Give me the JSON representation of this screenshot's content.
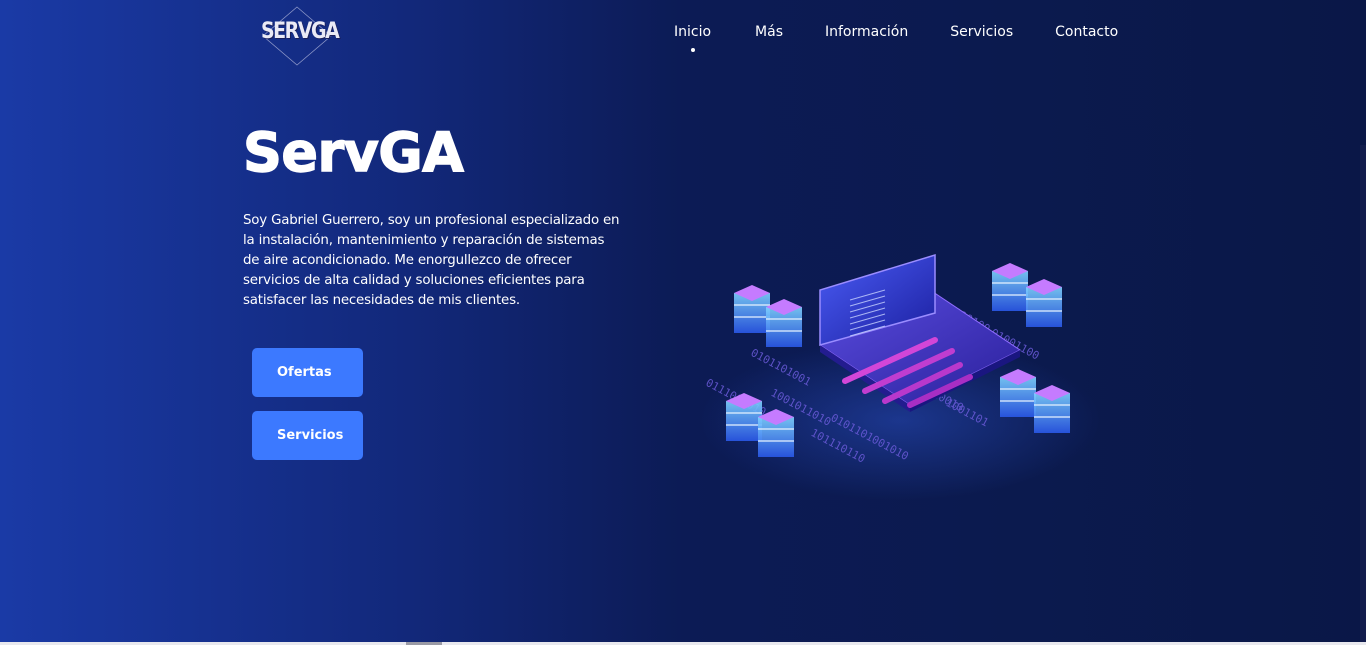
{
  "brand": {
    "logo_text": "SERVGA"
  },
  "nav": {
    "items": [
      {
        "label": "Inicio",
        "active": true
      },
      {
        "label": "Más",
        "active": false
      },
      {
        "label": "Información",
        "active": false
      },
      {
        "label": "Servicios",
        "active": false
      },
      {
        "label": "Contacto",
        "active": false
      }
    ]
  },
  "hero": {
    "title": "ServGA",
    "description": "Soy Gabriel Guerrero, soy un profesional especializado en la instalación, mantenimiento y reparación de sistemas de aire acondicionado. Me enorgullezco de ofrecer servicios de alta calidad y soluciones eficientes para satisfacer las necesidades de mis clientes.",
    "buttons": {
      "ofertas": "Ofertas",
      "servicios": "Servicios"
    },
    "illustration": "isometric-laptop-servers-icon"
  },
  "colors": {
    "accent": "#3c79ff",
    "bg_left": "#1a3aa6",
    "bg_right": "#0a1747"
  }
}
